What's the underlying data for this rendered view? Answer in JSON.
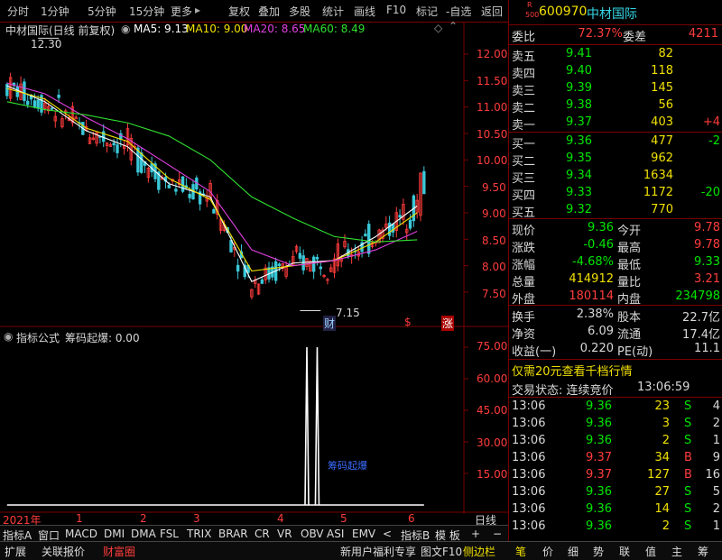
{
  "toolbar": {
    "left_items": [
      "分时",
      "1分钟",
      "5分钟",
      "15分钟",
      "更多"
    ],
    "more_arrow": "▸",
    "right_items": [
      "复权",
      "叠加",
      "多股",
      "统计",
      "画线",
      "F10",
      "标记",
      "-自选",
      "返回"
    ]
  },
  "chart": {
    "title": "中材国际(日线 前复权)",
    "ma": [
      {
        "label": "MA5: 9.13",
        "color": "#ffffff"
      },
      {
        "label": "MA10: 9.00",
        "color": "#f0e000"
      },
      {
        "label": "MA20: 8.65",
        "color": "#e040e0"
      },
      {
        "label": "MA60: 8.49",
        "color": "#30e030"
      }
    ],
    "price_axis": [
      "12.00",
      "11.50",
      "11.00",
      "10.50",
      "10.00",
      "9.50",
      "9.00",
      "8.50",
      "8.00",
      "7.50"
    ],
    "high_mark": "12.30",
    "low_mark": "7.15",
    "events": [
      "财",
      "$",
      "涨"
    ],
    "indicator_title": "指标公式",
    "indicator_value": "筹码起爆: 0.00",
    "indicator_axis": [
      "75.00",
      "60.00",
      "45.00",
      "30.00",
      "15.00"
    ],
    "indicator_label": "筹码起爆",
    "date_axis": [
      "2021年",
      "1",
      "2",
      "3",
      "4",
      "5",
      "6"
    ],
    "period": "日线"
  },
  "chart_data": [
    {
      "type": "line",
      "title": "中材国际(日线 前复权)",
      "ylim": [
        7.15,
        12.3
      ],
      "x": [
        1,
        12,
        24,
        36,
        48,
        60,
        72,
        84,
        96,
        108,
        120
      ],
      "series": [
        {
          "name": "MA5",
          "values": [
            11.4,
            11.1,
            10.55,
            10.25,
            9.55,
            9.3,
            7.7,
            8.05,
            8.1,
            8.55,
            9.13
          ]
        },
        {
          "name": "MA10",
          "values": [
            11.35,
            11.15,
            10.6,
            10.35,
            9.65,
            9.25,
            7.9,
            8.0,
            8.1,
            8.45,
            9.0
          ]
        },
        {
          "name": "MA20",
          "values": [
            11.45,
            11.25,
            10.8,
            10.4,
            9.9,
            9.4,
            8.3,
            8.0,
            8.1,
            8.3,
            8.65
          ]
        },
        {
          "name": "MA60",
          "values": [
            11.1,
            10.95,
            10.85,
            10.7,
            10.45,
            10.0,
            9.3,
            8.9,
            8.55,
            8.45,
            8.49
          ]
        }
      ]
    },
    {
      "type": "bar",
      "title": "筹码起爆",
      "ylim": [
        0,
        78
      ],
      "x": [
        88,
        91
      ],
      "values": [
        75,
        75
      ]
    }
  ],
  "quote": {
    "badge_top": "R",
    "badge_bottom": "500",
    "code": "600970",
    "name": "中材国际",
    "webi_label": "委比",
    "webi_value": "72.37%",
    "wecha_label": "委差",
    "wecha_value": "4211",
    "asks": [
      {
        "label": "卖五",
        "price": "9.41",
        "vol": "82",
        "chg": ""
      },
      {
        "label": "卖四",
        "price": "9.40",
        "vol": "118",
        "chg": ""
      },
      {
        "label": "卖三",
        "price": "9.39",
        "vol": "145",
        "chg": ""
      },
      {
        "label": "卖二",
        "price": "9.38",
        "vol": "56",
        "chg": ""
      },
      {
        "label": "卖一",
        "price": "9.37",
        "vol": "403",
        "chg": "+4"
      }
    ],
    "bids": [
      {
        "label": "买一",
        "price": "9.36",
        "vol": "477",
        "chg": "-2"
      },
      {
        "label": "买二",
        "price": "9.35",
        "vol": "962",
        "chg": ""
      },
      {
        "label": "买三",
        "price": "9.34",
        "vol": "1634",
        "chg": ""
      },
      {
        "label": "买四",
        "price": "9.33",
        "vol": "1172",
        "chg": "-20"
      },
      {
        "label": "买五",
        "price": "9.32",
        "vol": "770",
        "chg": ""
      }
    ],
    "stats": [
      {
        "l1": "现价",
        "v1": "9.36",
        "l2": "今开",
        "v2": "9.78"
      },
      {
        "l1": "涨跌",
        "v1": "-0.46",
        "l2": "最高",
        "v2": "9.78"
      },
      {
        "l1": "涨幅",
        "v1": "-4.68%",
        "l2": "最低",
        "v2": "9.33"
      },
      {
        "l1": "总量",
        "v1": "414912",
        "l2": "量比",
        "v2": "3.21"
      },
      {
        "l1": "外盘",
        "v1": "180114",
        "l2": "内盘",
        "v2": "234798"
      }
    ],
    "stats2": [
      {
        "l1": "换手",
        "v1": "2.38%",
        "l2": "股本",
        "v2": "22.7亿"
      },
      {
        "l1": "净资",
        "v1": "6.09",
        "l2": "流通",
        "v2": "17.4亿"
      },
      {
        "l1": "收益(一)",
        "v1": "0.220",
        "l2": "PE(动)",
        "v2": "11.1"
      }
    ],
    "promo": "仅需20元查看千档行情",
    "trade_state_label": "交易状态: 连续竞价",
    "trade_state_time": "13:06:59",
    "ticks": [
      {
        "time": "13:06",
        "price": "9.36",
        "vol": "23",
        "side": "S",
        "n": "4"
      },
      {
        "time": "13:06",
        "price": "9.36",
        "vol": "3",
        "side": "S",
        "n": "2"
      },
      {
        "time": "13:06",
        "price": "9.36",
        "vol": "2",
        "side": "S",
        "n": "1"
      },
      {
        "time": "13:06",
        "price": "9.37",
        "vol": "34",
        "side": "B",
        "n": "9"
      },
      {
        "time": "13:06",
        "price": "9.37",
        "vol": "127",
        "side": "B",
        "n": "16"
      },
      {
        "time": "13:06",
        "price": "9.36",
        "vol": "27",
        "side": "S",
        "n": "5"
      },
      {
        "time": "13:06",
        "price": "9.36",
        "vol": "14",
        "side": "S",
        "n": "2"
      },
      {
        "time": "13:06",
        "price": "9.36",
        "vol": "2",
        "side": "S",
        "n": "1"
      }
    ]
  },
  "tabs": [
    "指标A",
    "窗口",
    "MACD",
    "DMI",
    "DMA",
    "FSL",
    "TRIX",
    "BRAR",
    "CR",
    "VR",
    "OBV",
    "ASI",
    "EMV",
    "<",
    "指标B",
    "模 板",
    "+",
    "−"
  ],
  "status": {
    "left": [
      "扩展",
      "关联报价",
      "财富圈"
    ],
    "middle": [
      "新用户福利专享",
      "图文F10",
      "侧边栏"
    ],
    "right_tabs": [
      "笔",
      "价",
      "细",
      "势",
      "联",
      "值",
      "主",
      "筹"
    ]
  },
  "colors": {
    "up": "#ff3c3c",
    "down": "#00e600",
    "border": "#7a0000",
    "cyan": "#35d7e6"
  }
}
